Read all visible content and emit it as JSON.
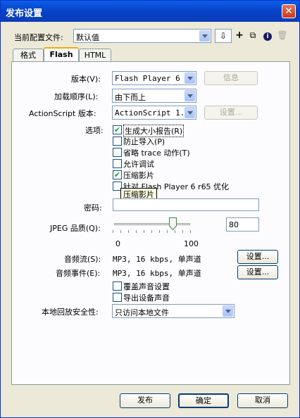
{
  "window": {
    "title": "发布设置",
    "close_glyph": "✕"
  },
  "profile": {
    "label": "当前配置文件:",
    "value": "默认值"
  },
  "tabs": [
    {
      "label": "格式"
    },
    {
      "label": "Flash"
    },
    {
      "label": "HTML"
    }
  ],
  "version": {
    "label": "版本(V):",
    "value": "Flash Player 6",
    "info_button": "信息"
  },
  "load_order": {
    "label": "加载顺序(L):",
    "value": "由下而上"
  },
  "actionscript": {
    "label": "ActionScript 版本:",
    "value": "ActionScript 1.0",
    "settings_button": "设置..."
  },
  "options": {
    "label": "选项:",
    "items": [
      {
        "label": "生成大小报告(R)",
        "checked": true
      },
      {
        "label": "防止导入(P)",
        "checked": false
      },
      {
        "label": "省略 trace 动作(T)",
        "checked": false
      },
      {
        "label": "允许调试",
        "checked": false
      },
      {
        "label": "压缩影片",
        "checked": true
      },
      {
        "label": "针对 Flash Player 6 r65 优化",
        "checked": false
      }
    ],
    "tooltip": "压缩影片"
  },
  "password": {
    "label": "密码:",
    "value": ""
  },
  "jpeg": {
    "label": "JPEG 品质(Q):",
    "value": "80",
    "min": "0",
    "max": "100",
    "level": 80
  },
  "audio_stream": {
    "label": "音频流(S):",
    "value": "MP3, 16 kbps, 单声道",
    "button": "设置..."
  },
  "audio_event": {
    "label": "音频事件(E):",
    "value": "MP3, 16 kbps, 单声道",
    "button": "设置..."
  },
  "audio_options": [
    {
      "label": "覆盖声音设置",
      "checked": false
    },
    {
      "label": "导出设备声音",
      "checked": false
    }
  ],
  "local_playback": {
    "label": "本地回放安全性:",
    "value": "只访问本地文件"
  },
  "footer": {
    "publish": "发布",
    "ok": "确定",
    "cancel": "取消"
  },
  "colors": {
    "title_bar": "#0842c8",
    "dialog_bg": "#ECE9D8",
    "check_green": "#21a121"
  }
}
